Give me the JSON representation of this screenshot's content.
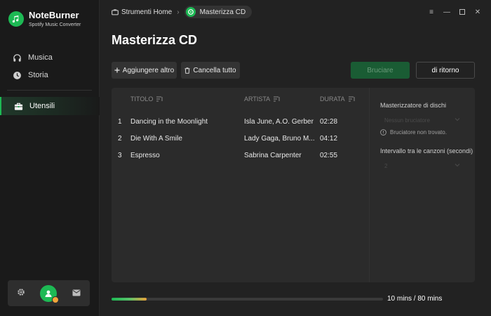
{
  "brand": {
    "name": "NoteBurner",
    "subtitle": "Spotify Music Converter"
  },
  "sidebar": {
    "items": [
      {
        "label": "Musica",
        "icon": "headphones-icon"
      },
      {
        "label": "Storia",
        "icon": "clock-icon"
      }
    ],
    "active_item": {
      "label": "Utensili",
      "icon": "toolbox-icon"
    },
    "bottom": [
      "settings-icon",
      "user-avatar",
      "mail-icon"
    ]
  },
  "breadcrumb": {
    "parent": "Strumenti Home",
    "current": "Masterizza CD"
  },
  "page": {
    "title": "Masterizza CD"
  },
  "toolbar": {
    "add_label": "Aggiungere altro",
    "clear_label": "Cancella tutto",
    "burn_label": "Bruciare",
    "back_label": "di ritorno"
  },
  "table": {
    "columns": {
      "title": "TITOLO",
      "artist": "ARTISTA",
      "duration": "DURATA"
    },
    "rows": [
      {
        "index": "1",
        "title": "Dancing in the Moonlight",
        "artist": "Isla June, A.O. Gerber",
        "duration": "02:28"
      },
      {
        "index": "2",
        "title": "Die With A Smile",
        "artist": "Lady Gaga, Bruno M...",
        "duration": "04:12"
      },
      {
        "index": "3",
        "title": "Espresso",
        "artist": "Sabrina Carpenter",
        "duration": "02:55"
      }
    ]
  },
  "settings": {
    "burner_label": "Masterizzatore di dischi",
    "burner_placeholder": "Nessun bruciatore",
    "burner_warning": "Bruciatore non trovato.",
    "gap_label": "Intervallo tra le canzoni (secondi)",
    "gap_value": "2"
  },
  "progress": {
    "value_fraction": 0.13,
    "text": "10 mins / 80 mins"
  },
  "colors": {
    "accent": "#1db954",
    "progress_end": "#e8a23a"
  }
}
